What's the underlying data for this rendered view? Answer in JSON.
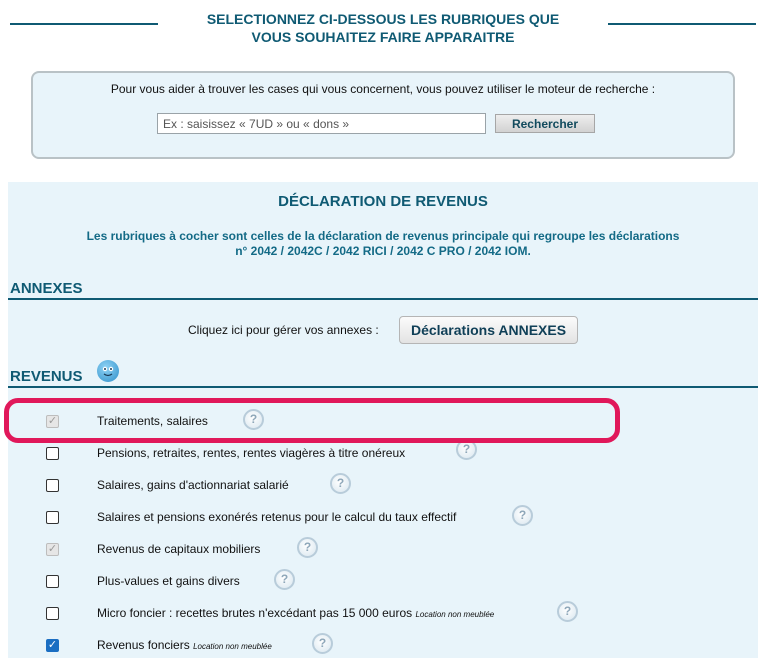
{
  "header": {
    "title_line1": "SELECTIONNEZ CI-DESSOUS LES RUBRIQUES QUE",
    "title_line2": "VOUS SOUHAITEZ FAIRE APPARAITRE"
  },
  "search": {
    "help_text": "Pour vous aider à trouver les cases qui vous concernent, vous pouvez utiliser le moteur de recherche :",
    "placeholder": "Ex : saisissez « 7UD » ou « dons »",
    "button_label": "Rechercher"
  },
  "declaration": {
    "title": "DÉCLARATION DE REVENUS",
    "subtitle_line1": "Les rubriques à cocher sont celles de la déclaration de revenus principale qui regroupe les déclarations",
    "subtitle_line2": "n° 2042 / 2042C / 2042 RICI / 2042 C PRO / 2042 IOM."
  },
  "annexes": {
    "heading": "ANNEXES",
    "prompt": "Cliquez ici pour gérer vos annexes :",
    "button_label": "Déclarations ANNEXES"
  },
  "revenus": {
    "heading": "REVENUS",
    "items": [
      {
        "label": "Traitements, salaires",
        "note": "",
        "state": "disabled-checked"
      },
      {
        "label": "Pensions, retraites, rentes, rentes viagères à titre onéreux",
        "note": "",
        "state": "unchecked"
      },
      {
        "label": "Salaires, gains d'actionnariat salarié",
        "note": "",
        "state": "unchecked"
      },
      {
        "label": "Salaires et pensions exonérés retenus pour le calcul du taux effectif",
        "note": "",
        "state": "unchecked"
      },
      {
        "label": "Revenus de capitaux mobiliers",
        "note": "",
        "state": "disabled-checked"
      },
      {
        "label": "Plus-values et gains divers",
        "note": "",
        "state": "unchecked"
      },
      {
        "label": "Micro foncier : recettes brutes n'excédant pas 15 000 euros",
        "note": "Location non meublée",
        "state": "unchecked"
      },
      {
        "label": "Revenus fonciers",
        "note": "Location non meublée",
        "state": "checked"
      }
    ],
    "help_glyph": "?",
    "check_glyph": "✓"
  },
  "colors": {
    "heading": "#0f5a73",
    "panel_bg": "#e8f4fa",
    "highlight": "#e0185a"
  }
}
